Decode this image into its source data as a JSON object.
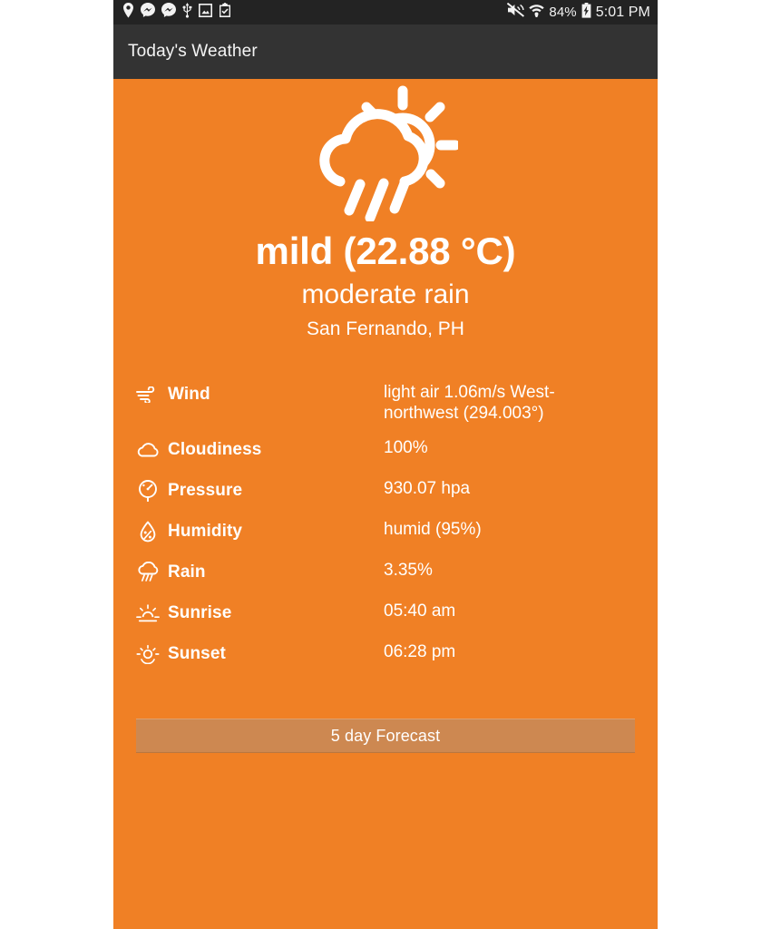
{
  "status_bar": {
    "background": "#232323",
    "left_icons": [
      {
        "name": "location-pin-icon"
      },
      {
        "name": "messenger-icon"
      },
      {
        "name": "messenger-icon"
      },
      {
        "name": "usb-icon"
      },
      {
        "name": "screenshot-image-icon"
      },
      {
        "name": "clipboard-check-icon"
      }
    ],
    "right_icons": [
      {
        "name": "volume-mute-icon"
      },
      {
        "name": "wifi-icon"
      },
      {
        "name": "battery-charging-icon"
      }
    ],
    "battery_percent": "84%",
    "clock": "5:01 PM"
  },
  "app_bar": {
    "title": "Today's Weather",
    "background": "#333333"
  },
  "theme": {
    "accent": "#f08025",
    "button": "#cd8851",
    "text": "#ffffff"
  },
  "hero": {
    "weather_icon": "sun-behind-rain-cloud-icon",
    "temperature": "mild (22.88 °C)",
    "condition": "moderate rain",
    "location": "San Fernando, PH"
  },
  "details": [
    {
      "icon": "wind-icon",
      "label": "Wind",
      "value": "light air 1.06m/s West-northwest (294.003°)"
    },
    {
      "icon": "cloud-icon",
      "label": "Cloudiness",
      "value": "100%"
    },
    {
      "icon": "barometer-icon",
      "label": "Pressure",
      "value": "930.07 hpa"
    },
    {
      "icon": "droplet-percent-icon",
      "label": "Humidity",
      "value": "humid (95%)"
    },
    {
      "icon": "rain-cloud-icon",
      "label": "Rain",
      "value": "3.35%"
    },
    {
      "icon": "sunrise-icon",
      "label": "Sunrise",
      "value": "05:40 am"
    },
    {
      "icon": "sunset-icon",
      "label": "Sunset",
      "value": "06:28 pm"
    }
  ],
  "forecast_button": {
    "label": "5 day Forecast"
  }
}
